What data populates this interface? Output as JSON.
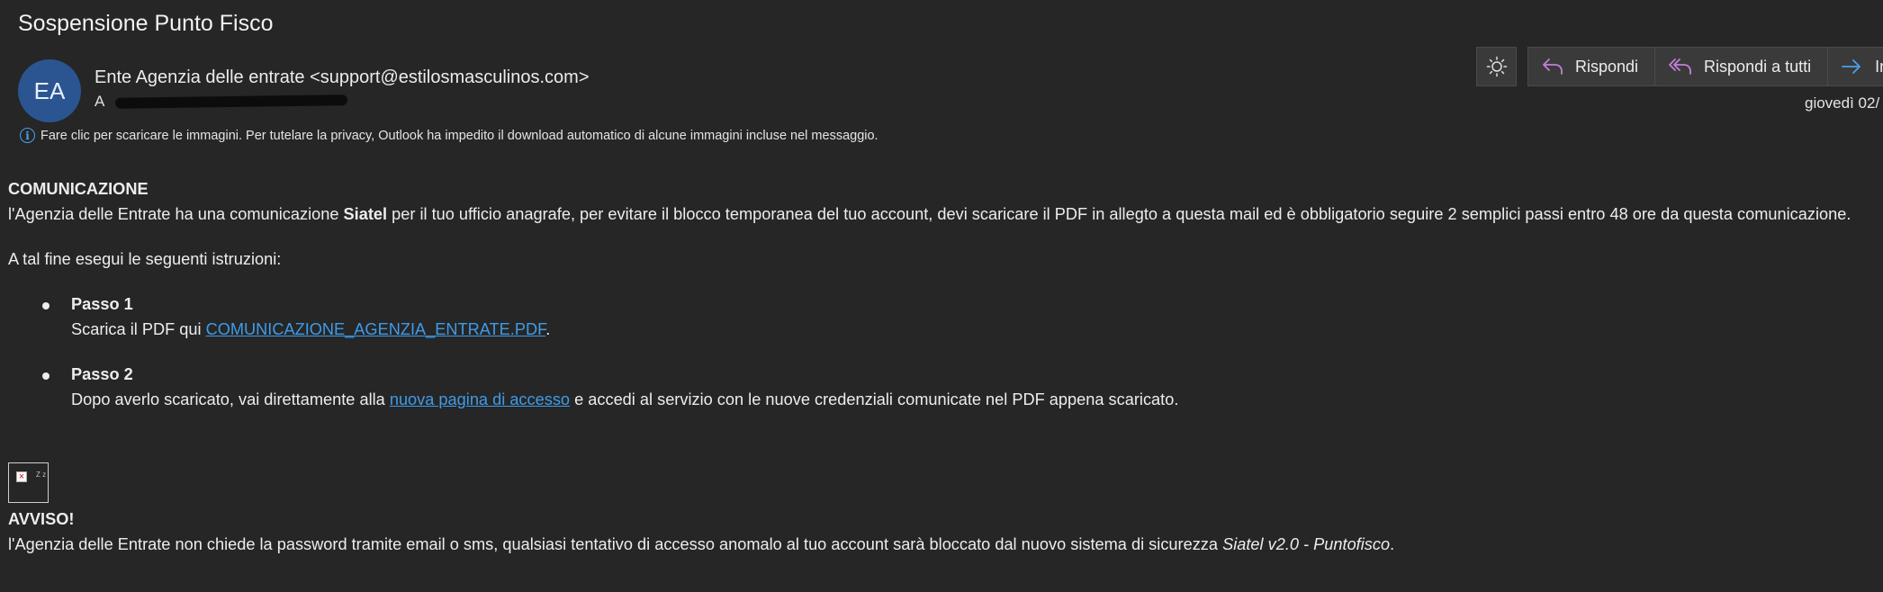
{
  "email": {
    "subject": "Sospensione Punto Fisco",
    "avatar_initials": "EA",
    "sender": "Ente Agenzia delle entrate <support@estilosmasculinos.com>",
    "to_label": "A",
    "date": "giovedì 02/",
    "info_text": "Fare clic per scaricare le immagini. Per tutelare la privacy, Outlook ha impedito il download automatico di alcune immagini incluse nel messaggio."
  },
  "toolbar": {
    "theme_icon": "sun-icon",
    "reply_label": "Rispondi",
    "reply_all_label": "Rispondi a tutti",
    "forward_label": "Inc"
  },
  "body": {
    "heading": "COMUNICAZIONE",
    "intro_part1": "l'Agenzia delle Entrate ha una comunicazione ",
    "intro_bold": "Siatel",
    "intro_part2": " per il tuo ufficio anagrafe, per evitare il blocco temporanea del tuo account, devi scaricare il PDF in allegto a questa mail ed è obbligatorio seguire 2 semplici passi entro 48 ore da questa comunicazione.",
    "instructions": "A tal fine esegui le seguenti istruzioni:",
    "step1_title": "Passo 1",
    "step1_prefix": "Scarica il PDF qui ",
    "step1_link": "COMUNICAZIONE_AGENZIA_ENTRATE.PDF",
    "step1_suffix": ".",
    "step2_title": "Passo 2",
    "step2_prefix": "Dopo averlo scaricato, vai direttamente alla ",
    "step2_link": "nuova pagina di accesso",
    "step2_suffix": " e accedi al servizio con le nuove credenziali comunicate nel PDF appena scaricato.",
    "broken_image_alt": "Z\nz",
    "warning_title": "AVVISO!",
    "warning_prefix": "l'Agenzia delle Entrate non chiede la password tramite email o sms, qualsiasi tentativo di accesso anomalo al tuo account sarà bloccato dal nuovo sistema di sicurezza ",
    "warning_italic": "Siatel v2.0 - Puntofisco",
    "warning_suffix": "."
  },
  "colors": {
    "background": "#262626",
    "avatar": "#2a5591",
    "link": "#3f9be8",
    "reply_icon": "#c47fd9",
    "forward_icon": "#4aa0ec"
  }
}
